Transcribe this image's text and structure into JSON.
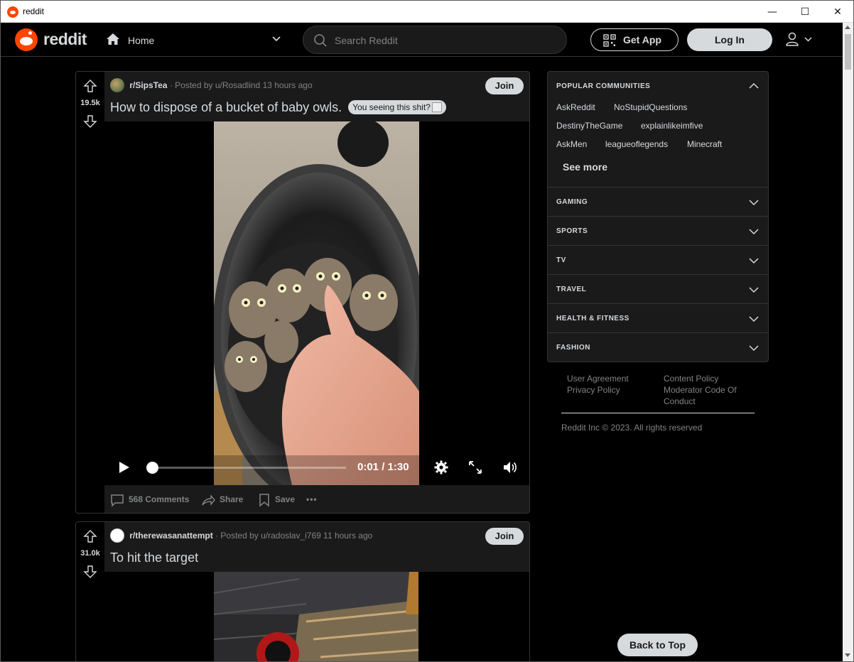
{
  "window": {
    "title": "reddit",
    "controls": {
      "minimize": "—",
      "maximize": "☐",
      "close": "✕"
    }
  },
  "header": {
    "logo_text": "reddit",
    "home_label": "Home",
    "search_placeholder": "Search Reddit",
    "get_app_label": "Get App",
    "login_label": "Log In"
  },
  "posts": [
    {
      "votes": "19.5k",
      "subreddit": "r/SipsTea",
      "meta": "· Posted by u/Rosadlind 13 hours ago",
      "join_label": "Join",
      "title": "How to dispose of a bucket of baby owls.",
      "flair": "You seeing this shit?",
      "video": {
        "time": "0:01 / 1:30",
        "progress": 0.01
      },
      "actions": {
        "comments": "568 Comments",
        "share": "Share",
        "save": "Save",
        "more": "•••"
      }
    },
    {
      "votes": "31.0k",
      "subreddit": "r/therewasanattempt",
      "meta": "· Posted by u/radoslav_i769 11 hours ago",
      "join_label": "Join",
      "title": "To hit the target"
    }
  ],
  "sidebar": {
    "popular_title": "POPULAR COMMUNITIES",
    "popular": [
      "AskReddit",
      "NoStupidQuestions",
      "DestinyTheGame",
      "explainlikeimfive",
      "AskMen",
      "leagueoflegends",
      "Minecraft"
    ],
    "see_more": "See more",
    "sections": [
      "GAMING",
      "SPORTS",
      "TV",
      "TRAVEL",
      "HEALTH & FITNESS",
      "FASHION"
    ]
  },
  "footer": {
    "links": [
      "User Agreement",
      "Privacy Policy",
      "Content Policy",
      "Moderator Code Of",
      "Conduct"
    ],
    "copyright": "Reddit Inc © 2023. All rights reserved",
    "back_to_top": "Back to Top"
  },
  "colors": {
    "brand": "#ff4500",
    "bg": "#000000",
    "card": "#1a1a1b",
    "text": "#d7dadc",
    "muted": "#818384"
  }
}
